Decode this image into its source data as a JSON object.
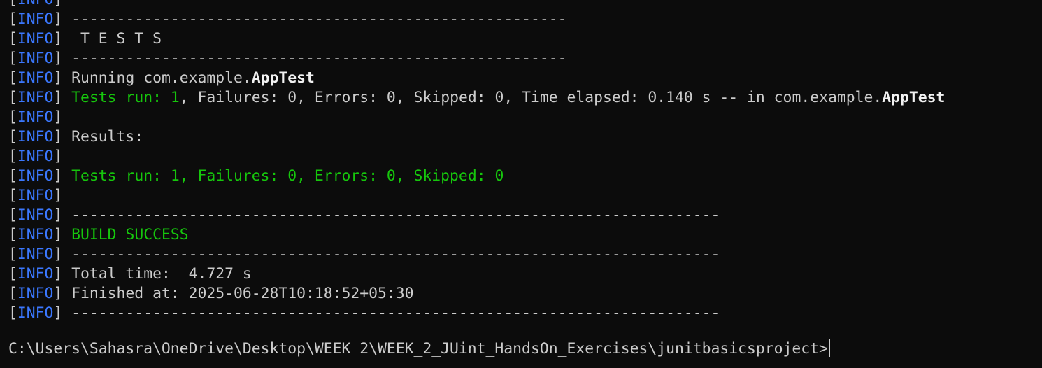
{
  "terminal": {
    "colors": {
      "background": "#0c0c0c",
      "text": "#cccccc",
      "info_blue": "#3b78ff",
      "success_green": "#16c60c",
      "bright": "#f2f2f2"
    },
    "lines": [
      {
        "segments": [
          {
            "text": "[",
            "color": "white"
          },
          {
            "text": "INFO",
            "color": "blue"
          },
          {
            "text": "] ",
            "color": "white"
          }
        ]
      },
      {
        "segments": [
          {
            "text": "[",
            "color": "white"
          },
          {
            "text": "INFO",
            "color": "blue"
          },
          {
            "text": "] -------------------------------------------------------",
            "color": "white"
          }
        ]
      },
      {
        "segments": [
          {
            "text": "[",
            "color": "white"
          },
          {
            "text": "INFO",
            "color": "blue"
          },
          {
            "text": "]  T E S T S",
            "color": "white"
          }
        ]
      },
      {
        "segments": [
          {
            "text": "[",
            "color": "white"
          },
          {
            "text": "INFO",
            "color": "blue"
          },
          {
            "text": "] -------------------------------------------------------",
            "color": "white"
          }
        ]
      },
      {
        "segments": [
          {
            "text": "[",
            "color": "white"
          },
          {
            "text": "INFO",
            "color": "blue"
          },
          {
            "text": "] Running com.example.",
            "color": "white"
          },
          {
            "text": "AppTest",
            "color": "bold"
          }
        ]
      },
      {
        "segments": [
          {
            "text": "[",
            "color": "white"
          },
          {
            "text": "INFO",
            "color": "blue"
          },
          {
            "text": "] ",
            "color": "white"
          },
          {
            "text": "Tests run: 1",
            "color": "green"
          },
          {
            "text": ", Failures: 0, Errors: 0, Skipped: 0, Time elapsed: 0.140 s -- in com.example.",
            "color": "white"
          },
          {
            "text": "AppTest",
            "color": "bold"
          }
        ]
      },
      {
        "segments": [
          {
            "text": "[",
            "color": "white"
          },
          {
            "text": "INFO",
            "color": "blue"
          },
          {
            "text": "]",
            "color": "white"
          }
        ]
      },
      {
        "segments": [
          {
            "text": "[",
            "color": "white"
          },
          {
            "text": "INFO",
            "color": "blue"
          },
          {
            "text": "] Results:",
            "color": "white"
          }
        ]
      },
      {
        "segments": [
          {
            "text": "[",
            "color": "white"
          },
          {
            "text": "INFO",
            "color": "blue"
          },
          {
            "text": "]",
            "color": "white"
          }
        ]
      },
      {
        "segments": [
          {
            "text": "[",
            "color": "white"
          },
          {
            "text": "INFO",
            "color": "blue"
          },
          {
            "text": "] ",
            "color": "white"
          },
          {
            "text": "Tests run: 1, Failures: 0, Errors: 0, Skipped: 0",
            "color": "green"
          }
        ]
      },
      {
        "segments": [
          {
            "text": "[",
            "color": "white"
          },
          {
            "text": "INFO",
            "color": "blue"
          },
          {
            "text": "]",
            "color": "white"
          }
        ]
      },
      {
        "segments": [
          {
            "text": "[",
            "color": "white"
          },
          {
            "text": "INFO",
            "color": "blue"
          },
          {
            "text": "] ------------------------------------------------------------------------",
            "color": "white"
          }
        ]
      },
      {
        "segments": [
          {
            "text": "[",
            "color": "white"
          },
          {
            "text": "INFO",
            "color": "blue"
          },
          {
            "text": "] ",
            "color": "white"
          },
          {
            "text": "BUILD SUCCESS",
            "color": "green"
          }
        ]
      },
      {
        "segments": [
          {
            "text": "[",
            "color": "white"
          },
          {
            "text": "INFO",
            "color": "blue"
          },
          {
            "text": "] ------------------------------------------------------------------------",
            "color": "white"
          }
        ]
      },
      {
        "segments": [
          {
            "text": "[",
            "color": "white"
          },
          {
            "text": "INFO",
            "color": "blue"
          },
          {
            "text": "] Total time:  4.727 s",
            "color": "white"
          }
        ]
      },
      {
        "segments": [
          {
            "text": "[",
            "color": "white"
          },
          {
            "text": "INFO",
            "color": "blue"
          },
          {
            "text": "] Finished at: 2025-06-28T10:18:52+05:30",
            "color": "white"
          }
        ]
      },
      {
        "segments": [
          {
            "text": "[",
            "color": "white"
          },
          {
            "text": "INFO",
            "color": "blue"
          },
          {
            "text": "] ------------------------------------------------------------------------",
            "color": "white"
          }
        ]
      }
    ],
    "prompt": "C:\\Users\\Sahasra\\OneDrive\\Desktop\\WEEK 2\\WEEK_2_JUint_HandsOn_Exercises\\junitbasicsproject>"
  }
}
